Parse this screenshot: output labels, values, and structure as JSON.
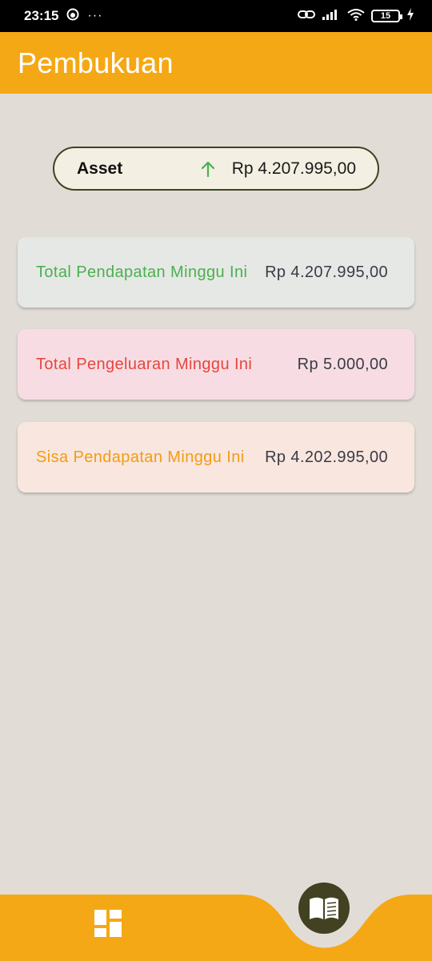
{
  "status_bar": {
    "time": "23:15",
    "dots": "···",
    "battery": "15"
  },
  "app_bar": {
    "title": "Pembukuan"
  },
  "asset": {
    "label": "Asset",
    "value": "Rp 4.207.995,00",
    "trend_icon": "arrow-up-icon",
    "trend_color": "#4caf50"
  },
  "cards": {
    "income": {
      "label": "Total Pendapatan Minggu Ini",
      "value": "Rp 4.207.995,00",
      "color": "#4caf50"
    },
    "expense": {
      "label": "Total Pengeluaran Minggu Ini",
      "value": "Rp 5.000,00",
      "color": "#e8453c"
    },
    "balance": {
      "label": "Sisa Pendapatan Minggu Ini",
      "value": "Rp 4.202.995,00",
      "color": "#f39c12"
    }
  },
  "bottom_nav": {
    "items": [
      {
        "icon": "dashboard-icon"
      },
      {
        "icon": "book-icon",
        "active": true
      }
    ]
  },
  "colors": {
    "accent": "#f5a815",
    "background": "#e1ddd6",
    "dark": "#424223"
  }
}
